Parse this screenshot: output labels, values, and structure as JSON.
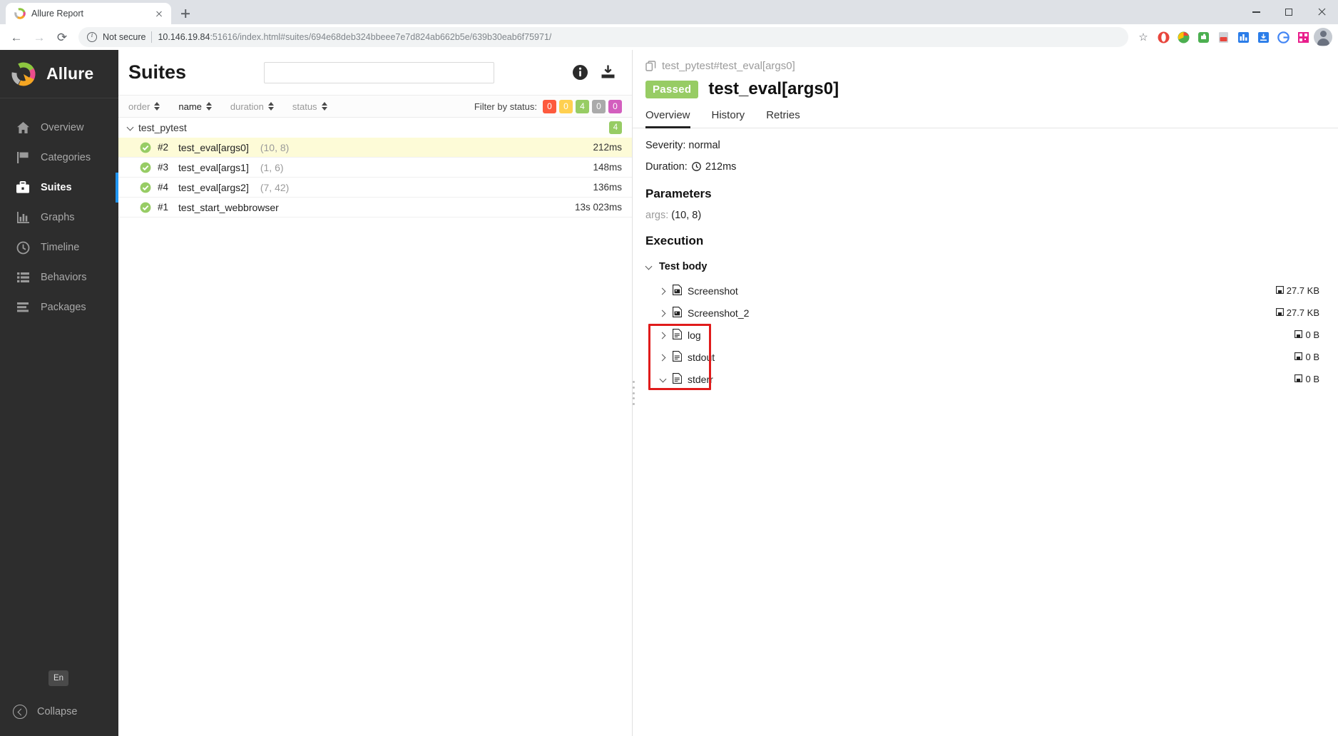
{
  "browser": {
    "tab": {
      "title": "Allure Report",
      "favicon": "allure-icon"
    },
    "newtab_label": "+",
    "nav": {
      "back": "back-arrow",
      "forward": "forward-arrow",
      "reload": "reload-icon"
    },
    "omnibox": {
      "security_text": "Not secure",
      "url_host": "10.146.19.84",
      "url_rest": ":51616/index.html#suites/694e68deb324bbeee7e7d824ab662b5e/639b30eab6f75971/"
    },
    "window": {
      "minimize": "minimize-icon",
      "maximize": "maximize-icon",
      "close": "close-icon"
    }
  },
  "sidebar": {
    "brand": "Allure",
    "items": [
      {
        "label": "Overview",
        "icon": "home-icon",
        "active": false
      },
      {
        "label": "Categories",
        "icon": "flag-icon",
        "active": false
      },
      {
        "label": "Suites",
        "icon": "briefcase-icon",
        "active": true
      },
      {
        "label": "Graphs",
        "icon": "bar-chart-icon",
        "active": false
      },
      {
        "label": "Timeline",
        "icon": "clock-icon",
        "active": false
      },
      {
        "label": "Behaviors",
        "icon": "list-icon",
        "active": false
      },
      {
        "label": "Packages",
        "icon": "layers-icon",
        "active": false
      }
    ],
    "language": "En",
    "collapse": "Collapse"
  },
  "suites": {
    "title": "Suites",
    "search_value": "",
    "search_placeholder": "",
    "info_icon": "info-icon",
    "download_icon": "download-icon",
    "sorts": [
      {
        "label": "order",
        "active": false
      },
      {
        "label": "name",
        "active": true
      },
      {
        "label": "duration",
        "active": false
      },
      {
        "label": "status",
        "active": false
      }
    ],
    "filter_label": "Filter by status:",
    "status_badges": [
      {
        "count": "0",
        "color": "#fd5a3e",
        "status": "failed"
      },
      {
        "count": "0",
        "color": "#ffd050",
        "status": "broken"
      },
      {
        "count": "4",
        "color": "#97cc64",
        "status": "passed"
      },
      {
        "count": "0",
        "color": "#aaaaaa",
        "status": "skipped"
      },
      {
        "count": "0",
        "color": "#d35ebe",
        "status": "unknown"
      }
    ],
    "group": {
      "name": "test_pytest",
      "count": "4",
      "expanded": true
    },
    "rows": [
      {
        "order": "#2",
        "name": "test_eval[args0]",
        "args": "(10, 8)",
        "duration": "212ms",
        "status": "passed",
        "selected": true
      },
      {
        "order": "#3",
        "name": "test_eval[args1]",
        "args": "(1, 6)",
        "duration": "148ms",
        "status": "passed",
        "selected": false
      },
      {
        "order": "#4",
        "name": "test_eval[args2]",
        "args": "(7, 42)",
        "duration": "136ms",
        "status": "passed",
        "selected": false
      },
      {
        "order": "#1",
        "name": "test_start_webbrowser",
        "args": "",
        "duration": "13s 023ms",
        "status": "passed",
        "selected": false
      }
    ]
  },
  "detail": {
    "breadcrumb": "test_pytest#test_eval[args0]",
    "status_badge": "Passed",
    "title": "test_eval[args0]",
    "tabs": [
      {
        "label": "Overview",
        "active": true
      },
      {
        "label": "History",
        "active": false
      },
      {
        "label": "Retries",
        "active": false
      }
    ],
    "severity": "Severity: normal",
    "duration_label": "Duration:",
    "duration_value": "212ms",
    "parameters_heading": "Parameters",
    "parameters": [
      {
        "key": "args:",
        "value": "(10, 8)"
      }
    ],
    "execution_heading": "Execution",
    "test_body": {
      "label": "Test body",
      "expanded": true
    },
    "attachments": [
      {
        "name": "Screenshot",
        "size": "27.7 KB",
        "icon": "image-file-icon",
        "expanded": false,
        "highlighted": false
      },
      {
        "name": "Screenshot_2",
        "size": "27.7 KB",
        "icon": "image-file-icon",
        "expanded": false,
        "highlighted": false
      },
      {
        "name": "log",
        "size": "0 B",
        "icon": "text-file-icon",
        "expanded": false,
        "highlighted": true
      },
      {
        "name": "stdout",
        "size": "0 B",
        "icon": "text-file-icon",
        "expanded": false,
        "highlighted": true
      },
      {
        "name": "stderr",
        "size": "0 B",
        "icon": "text-file-icon",
        "expanded": true,
        "highlighted": true
      }
    ],
    "annotation_color": "#e01b1b"
  }
}
